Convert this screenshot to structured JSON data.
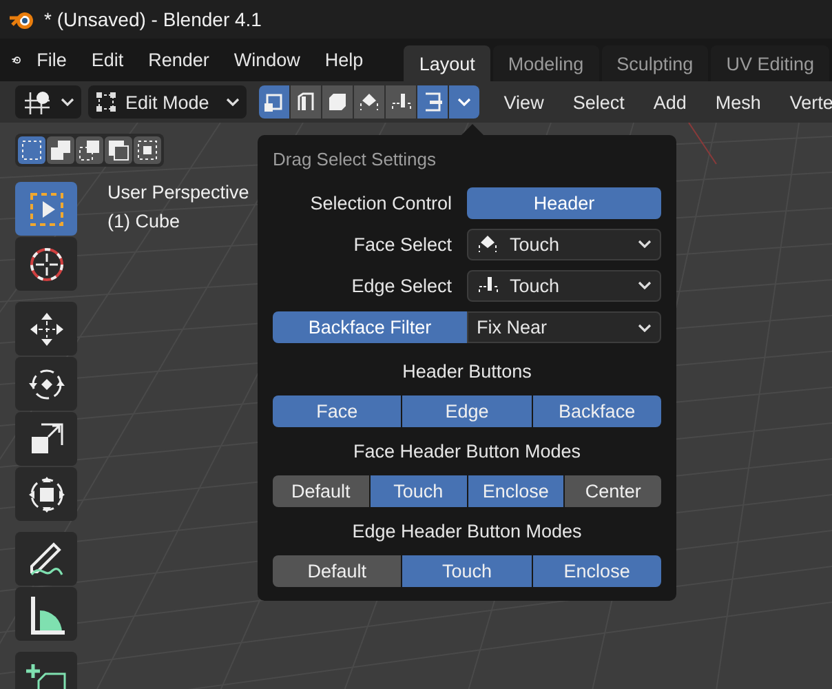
{
  "window": {
    "title": "* (Unsaved) - Blender 4.1"
  },
  "menu": [
    "File",
    "Edit",
    "Render",
    "Window",
    "Help"
  ],
  "workspaces": [
    {
      "label": "Layout",
      "selected": true
    },
    {
      "label": "Modeling",
      "selected": false
    },
    {
      "label": "Sculpting",
      "selected": false
    },
    {
      "label": "UV Editing",
      "selected": false
    }
  ],
  "header": {
    "mode": "Edit Mode",
    "select_modes": [
      {
        "kind": "vertex",
        "selected": true
      },
      {
        "kind": "edge",
        "selected": false
      },
      {
        "kind": "face",
        "selected": false
      },
      {
        "kind": "face-touch",
        "selected": false
      },
      {
        "kind": "edge-touch",
        "selected": false
      },
      {
        "kind": "backface",
        "selected": true
      },
      {
        "kind": "dropdown",
        "selected": true
      }
    ],
    "menus": [
      "View",
      "Select",
      "Add",
      "Mesh",
      "Verte"
    ]
  },
  "selection_modes": [
    {
      "kind": "new",
      "selected": true
    },
    {
      "kind": "extend",
      "selected": false
    },
    {
      "kind": "subtract",
      "selected": false
    },
    {
      "kind": "invert",
      "selected": false
    },
    {
      "kind": "intersect",
      "selected": false
    }
  ],
  "viewport": {
    "title": "User Perspective",
    "object": "(1) Cube"
  },
  "tool_groups": [
    {
      "tools": [
        {
          "kind": "select",
          "selected": true
        },
        {
          "kind": "cursor",
          "selected": false
        }
      ]
    },
    {
      "tools": [
        {
          "kind": "move",
          "selected": false
        },
        {
          "kind": "rotate",
          "selected": false
        },
        {
          "kind": "scale",
          "selected": false
        },
        {
          "kind": "transform",
          "selected": false
        }
      ]
    },
    {
      "tools": [
        {
          "kind": "annotate",
          "selected": false
        },
        {
          "kind": "measure",
          "selected": false
        }
      ]
    },
    {
      "tools": [
        {
          "kind": "add-cube",
          "selected": false
        }
      ]
    }
  ],
  "popup": {
    "title": "Drag Select Settings",
    "rows": [
      {
        "kind": "toggle",
        "label": "Selection Control",
        "value": "Header",
        "on": true
      },
      {
        "kind": "dropdown",
        "label": "Face Select",
        "value": "Touch"
      },
      {
        "kind": "dropdown",
        "label": "Edge Select",
        "value": "Touch"
      },
      {
        "kind": "split",
        "toggle": "Backface Filter",
        "on": true,
        "value": "Fix Near"
      }
    ],
    "sections": [
      {
        "heading": "Header Buttons",
        "options": [
          {
            "label": "Face",
            "selected": true
          },
          {
            "label": "Edge",
            "selected": true
          },
          {
            "label": "Backface",
            "selected": true
          }
        ]
      },
      {
        "heading": "Face Header Button Modes",
        "options": [
          {
            "label": "Default",
            "selected": false
          },
          {
            "label": "Touch",
            "selected": true
          },
          {
            "label": "Enclose",
            "selected": true
          },
          {
            "label": "Center",
            "selected": false
          }
        ]
      },
      {
        "heading": "Edge Header Button Modes",
        "options": [
          {
            "label": "Default",
            "selected": false
          },
          {
            "label": "Touch",
            "selected": true
          },
          {
            "label": "Enclose",
            "selected": true
          }
        ]
      }
    ]
  }
}
